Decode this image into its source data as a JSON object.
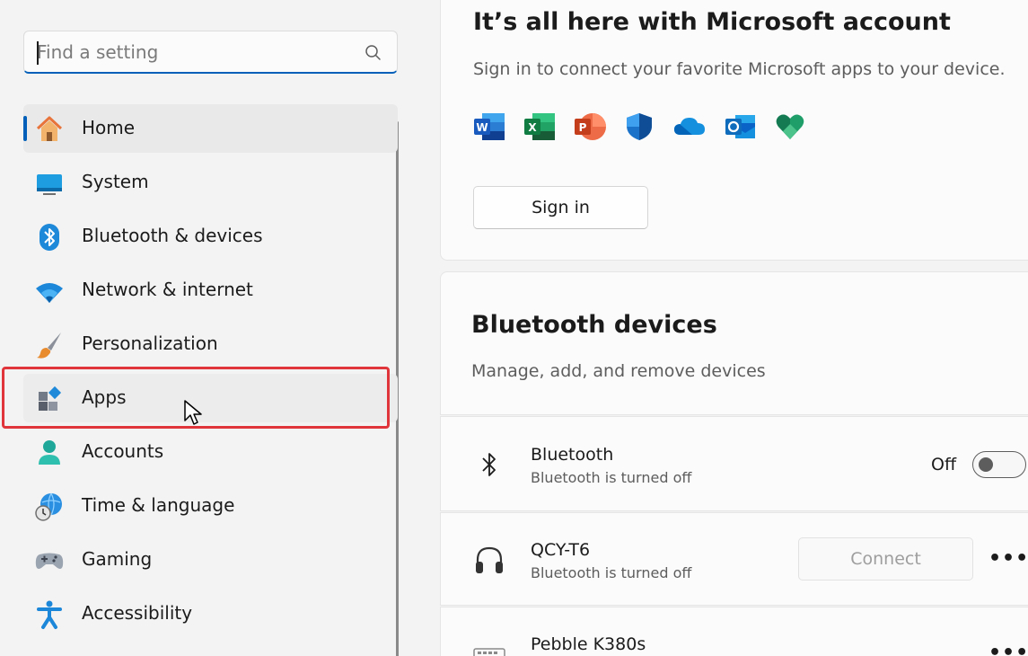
{
  "search": {
    "placeholder": "Find a setting"
  },
  "nav": {
    "items": [
      {
        "label": "Home",
        "icon": "home-icon"
      },
      {
        "label": "System",
        "icon": "system-icon"
      },
      {
        "label": "Bluetooth & devices",
        "icon": "bluetooth-icon"
      },
      {
        "label": "Network & internet",
        "icon": "wifi-icon"
      },
      {
        "label": "Personalization",
        "icon": "brush-icon"
      },
      {
        "label": "Apps",
        "icon": "apps-icon"
      },
      {
        "label": "Accounts",
        "icon": "person-icon"
      },
      {
        "label": "Time & language",
        "icon": "globe-clock-icon"
      },
      {
        "label": "Gaming",
        "icon": "gamepad-icon"
      },
      {
        "label": "Accessibility",
        "icon": "accessibility-icon"
      }
    ],
    "selected": "Home",
    "highlighted": "Apps"
  },
  "account_card": {
    "title": "It’s all here with Microsoft account",
    "subtitle": "Sign in to connect your favorite Microsoft apps to your device.",
    "app_icons": [
      "word-icon",
      "excel-icon",
      "powerpoint-icon",
      "defender-icon",
      "onedrive-icon",
      "outlook-icon",
      "family-safety-icon"
    ],
    "sign_in_label": "Sign in"
  },
  "bluetooth_card": {
    "title": "Bluetooth devices",
    "subtitle": "Manage, add, and remove devices"
  },
  "bluetooth_row": {
    "title": "Bluetooth",
    "status": "Bluetooth is turned off",
    "toggle_label": "Off",
    "toggle_on": false
  },
  "devices": [
    {
      "name": "QCY-T6",
      "status": "Bluetooth is turned off",
      "icon": "headphones-icon",
      "connect_label": "Connect",
      "more": "•••"
    },
    {
      "name": "Pebble K380s",
      "icon": "keyboard-icon",
      "more": "•••"
    }
  ],
  "colors": {
    "accent": "#005fb8",
    "highlight_border": "#e0353b"
  }
}
